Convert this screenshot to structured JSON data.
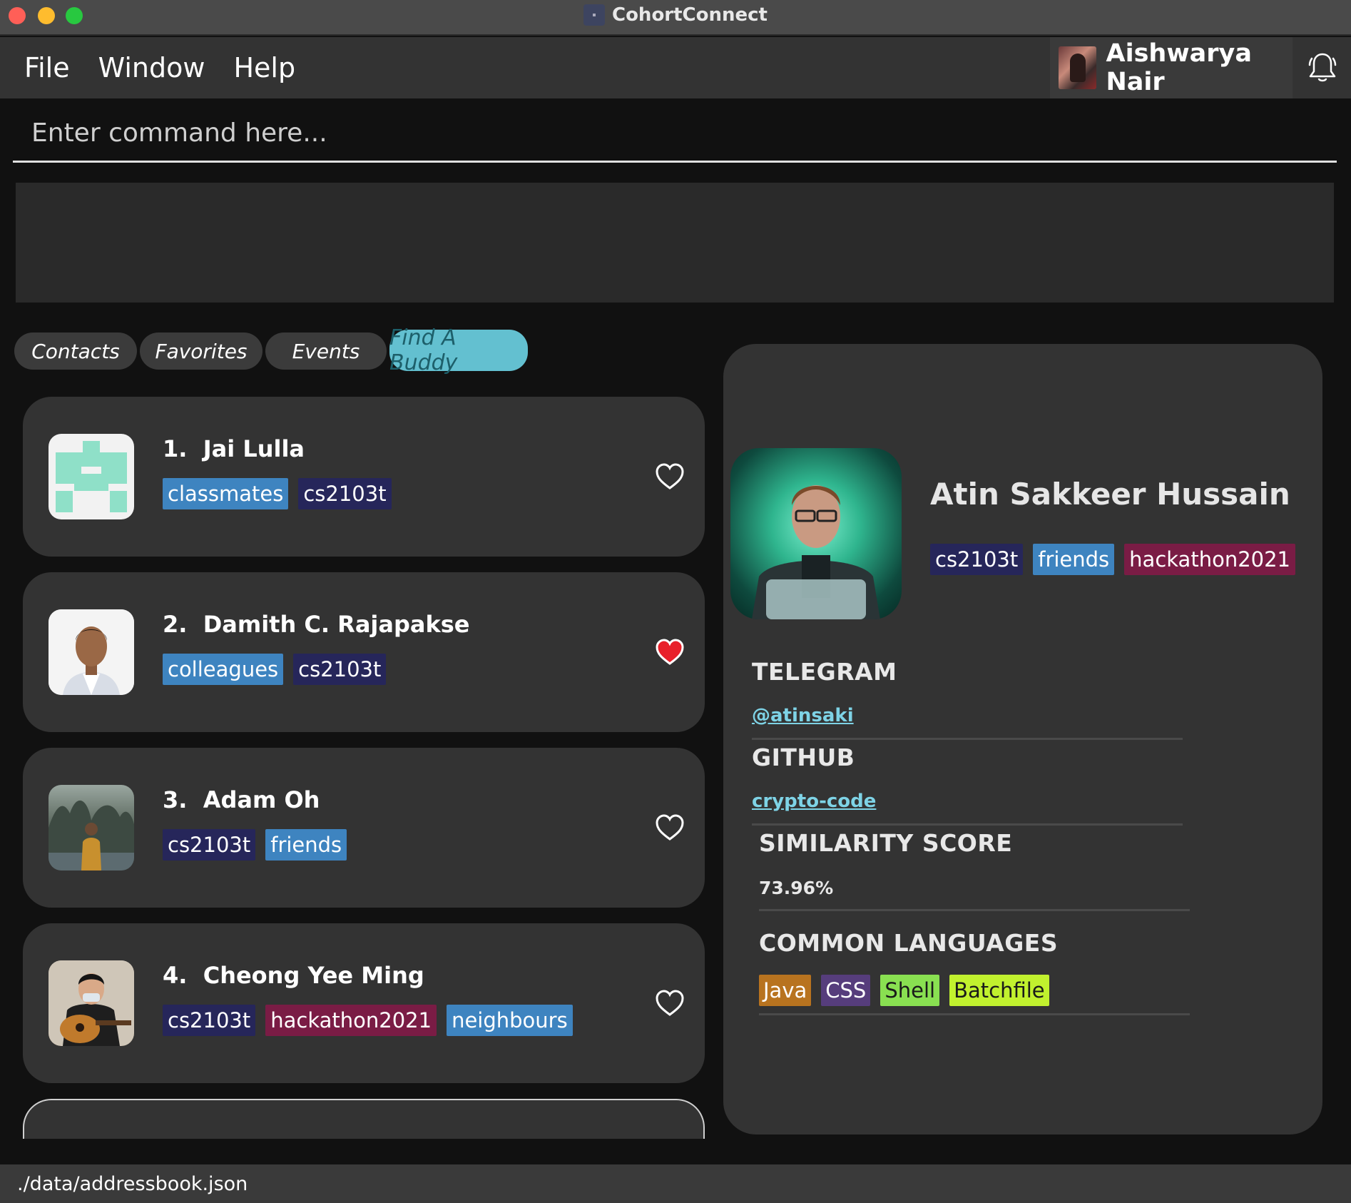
{
  "window": {
    "title": "CohortConnect"
  },
  "menu": {
    "items": [
      "File",
      "Window",
      "Help"
    ]
  },
  "user": {
    "name": "Aishwarya Nair"
  },
  "command": {
    "placeholder": "Enter command here..."
  },
  "tabs": [
    {
      "label": "Contacts"
    },
    {
      "label": "Favorites"
    },
    {
      "label": "Events"
    },
    {
      "label": "Find A Buddy",
      "active": true
    }
  ],
  "contacts": [
    {
      "index": "1.",
      "name": "Jai Lulla",
      "favorite": false,
      "tags": [
        {
          "label": "classmates",
          "color": "#3e84c0"
        },
        {
          "label": "cs2103t",
          "color": "#26265a"
        }
      ]
    },
    {
      "index": "2.",
      "name": "Damith C. Rajapakse",
      "favorite": true,
      "tags": [
        {
          "label": "colleagues",
          "color": "#3e84c0"
        },
        {
          "label": "cs2103t",
          "color": "#26265a"
        }
      ]
    },
    {
      "index": "3.",
      "name": "Adam Oh",
      "favorite": false,
      "tags": [
        {
          "label": "cs2103t",
          "color": "#26265a"
        },
        {
          "label": "friends",
          "color": "#3e84c0"
        }
      ]
    },
    {
      "index": "4.",
      "name": "Cheong Yee Ming",
      "favorite": false,
      "tags": [
        {
          "label": "cs2103t",
          "color": "#26265a"
        },
        {
          "label": "hackathon2021",
          "color": "#7a1c45"
        },
        {
          "label": "neighbours",
          "color": "#3e84c0"
        }
      ]
    }
  ],
  "detail": {
    "name": "Atin Sakkeer Hussain",
    "tags": [
      {
        "label": "cs2103t",
        "color": "#26265a"
      },
      {
        "label": "friends",
        "color": "#3e84c0"
      },
      {
        "label": "hackathon2021",
        "color": "#7a1c45"
      }
    ],
    "telegram_title": "TELEGRAM",
    "telegram": "@atinsaki",
    "github_title": "GITHUB",
    "github": "crypto-code",
    "similarity_title": "SIMILARITY SCORE",
    "similarity": "73.96%",
    "languages_title": "COMMON LANGUAGES",
    "languages": [
      {
        "label": "Java",
        "bg": "#b8731f",
        "fg": "#ffffff"
      },
      {
        "label": "CSS",
        "bg": "#563d7c",
        "fg": "#ffffff"
      },
      {
        "label": "Shell",
        "bg": "#89e051",
        "fg": "#1a1a1a"
      },
      {
        "label": "Batchfile",
        "bg": "#c1f12e",
        "fg": "#1a1a1a"
      }
    ]
  },
  "status": {
    "path": "./data/addressbook.json"
  },
  "colors": {
    "accent": "#63c0d0",
    "heart_active": "#e8202a"
  }
}
